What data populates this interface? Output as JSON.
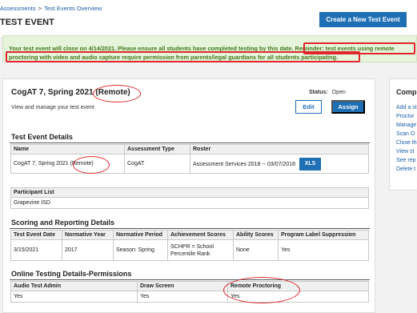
{
  "breadcrumb": {
    "root": "Assessments",
    "separator": ">",
    "current": "Test Events Overview"
  },
  "page_title": "TEST EVENT",
  "create_button": "Create a New Test Event",
  "notice": {
    "text": "Your test event will close on 4/14/2021. Please ensure all students have completed testing by this date.",
    "reminder_line1": "Reminder: test events using remote",
    "reminder_line2": "proctoring with video and audio capture require permission from parents/legal guardians for all students participating."
  },
  "event": {
    "title": "CogAT 7, Spring 2021",
    "title_tag": "(Remote)",
    "subtitle": "View and manage your test event",
    "status_label": "Status:",
    "status_value": "Open",
    "edit_label": "Edit",
    "assign_label": "Assign"
  },
  "details": {
    "title": "Test Event Details",
    "headers": [
      "Name",
      "Assessment Type",
      "Roster"
    ],
    "name": "CogAT 7, Spring 2021",
    "name_tag": "(Remote)",
    "assessment_type": "CogAT",
    "roster": "Assessment Services 2018 -- 03/07/2018",
    "xls_label": "XLS"
  },
  "participants": {
    "header": "Participant List",
    "value": "Grapevine ISD"
  },
  "scoring": {
    "title": "Scoring and Reporting Details",
    "headers": [
      "Test Event Date",
      "Normative Year",
      "Normative Period",
      "Achievement Scores",
      "Ability Scores",
      "Program Label Suppression"
    ],
    "values": [
      "3/15/2021",
      "2017",
      "Season: Spring",
      "SCHPR = School Percentile Rank",
      "None",
      "Yes"
    ]
  },
  "permissions": {
    "title": "Online Testing Details-Permissions",
    "headers": [
      "Audio Test Admin",
      "Draw Screen",
      "Remote Proctoring"
    ],
    "values": [
      "Yes",
      "Yes",
      "Yes"
    ]
  },
  "side": {
    "title": "Comp",
    "links": [
      "Add a st",
      "Proctor",
      "Manage",
      "Scan O",
      "Close th",
      "View st",
      "See rep",
      "Delete t"
    ]
  },
  "colors": {
    "accent": "#1f6fb5",
    "notice_bg": "#e7f4dc",
    "notice_text": "#3f7a1a",
    "highlight": "#e0262c"
  }
}
